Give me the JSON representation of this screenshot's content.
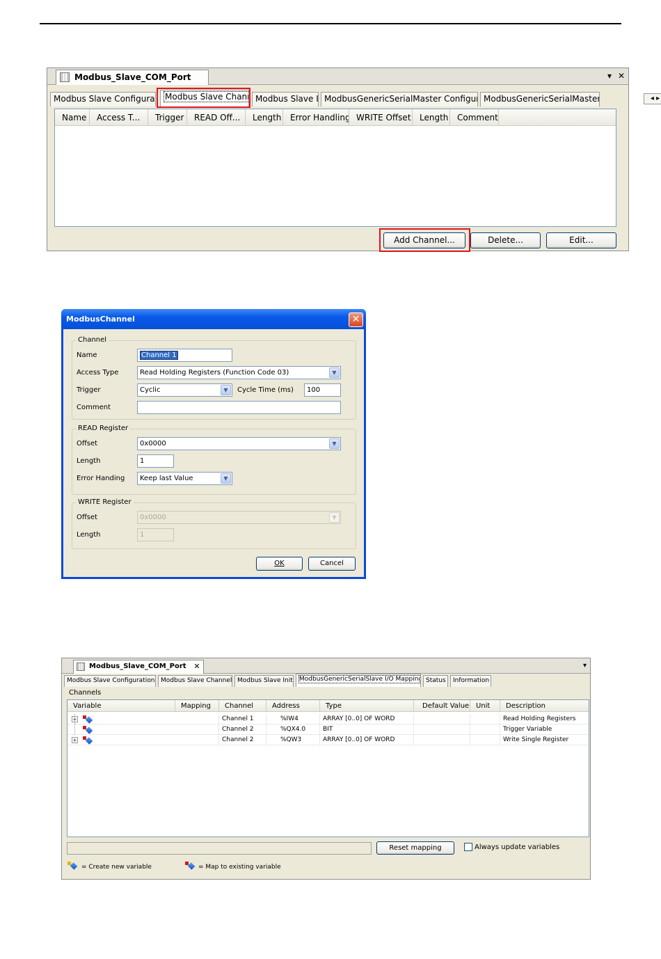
{
  "panel1": {
    "window_title": "Modbus_Slave_COM_Port",
    "header_controls": {
      "dropdown": "▾",
      "close": "✕"
    },
    "tabs": [
      {
        "label": "Modbus Slave Configuration"
      },
      {
        "label": "Modbus Slave Channel"
      },
      {
        "label": "Modbus Slave Init"
      },
      {
        "label": "ModbusGenericSerialMaster Configuration"
      },
      {
        "label": "ModbusGenericSerialMaster I/O M"
      }
    ],
    "tab_scroll": "◂ ▸",
    "columns": [
      "Name",
      "Access T...",
      "Trigger",
      "READ Off...",
      "Length",
      "Error Handling",
      "WRITE Offset",
      "Length",
      "Comment"
    ],
    "buttons": {
      "add": "Add Channel...",
      "delete": "Delete...",
      "edit": "Edit..."
    }
  },
  "dialog": {
    "title": "ModbusChannel",
    "close_glyph": "✕",
    "channel_group": {
      "title": "Channel",
      "name_label": "Name",
      "name_value": "Channel 1",
      "access_type_label": "Access Type",
      "access_type_value": "Read Holding Registers (Function Code 03)",
      "trigger_label": "Trigger",
      "trigger_value": "Cyclic",
      "cycle_time_label": "Cycle Time (ms)",
      "cycle_time_value": "100",
      "comment_label": "Comment",
      "comment_value": ""
    },
    "read_group": {
      "title": "READ Register",
      "offset_label": "Offset",
      "offset_value": "0x0000",
      "length_label": "Length",
      "length_value": "1",
      "error_label": "Error Handing",
      "error_value": "Keep last Value"
    },
    "write_group": {
      "title": "WRITE Register",
      "offset_label": "Offset",
      "offset_value": "0x0000",
      "length_label": "Length",
      "length_value": "1"
    },
    "ok": "OK",
    "cancel": "Cancel"
  },
  "panel3": {
    "window_title": "Modbus_Slave_COM_Port",
    "close_glyph": "✕",
    "dropdown_glyph": "▾",
    "tabs": [
      {
        "label": "Modbus Slave Configuration"
      },
      {
        "label": "Modbus Slave Channel"
      },
      {
        "label": "Modbus Slave Init"
      },
      {
        "label": "ModbusGenericSerialSlave I/O Mapping"
      },
      {
        "label": "Status"
      },
      {
        "label": "Information"
      }
    ],
    "section_label": "Channels",
    "columns": [
      "Variable",
      "Mapping",
      "Channel",
      "Address",
      "Type",
      "Default Value",
      "Unit",
      "Description"
    ],
    "rows": [
      {
        "expand": "+",
        "channel": "Channel 1",
        "address": "%IW4",
        "type": "ARRAY [0..0] OF WORD",
        "description": "Read Holding Registers"
      },
      {
        "expand": "",
        "channel": "Channel 2",
        "address": "%QX4.0",
        "type": "BIT",
        "description": "Trigger Variable"
      },
      {
        "expand": "+",
        "channel": "Channel 2",
        "address": "%QW3",
        "type": "ARRAY [0..0] OF WORD",
        "description": "Write Single Register"
      }
    ],
    "reset_button": "Reset mapping",
    "always_update_label": "Always update variables",
    "legend_create": "= Create new variable",
    "legend_map": "= Map to existing variable"
  }
}
